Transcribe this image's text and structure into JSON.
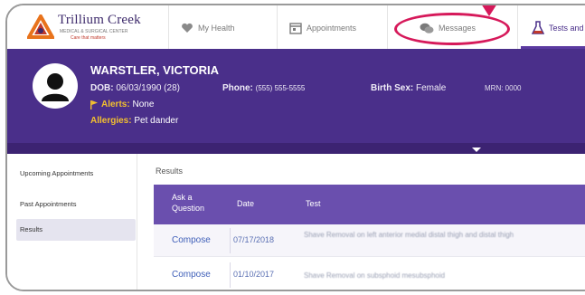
{
  "app": {
    "logo_name": "Trillium Creek",
    "logo_tagline": "MEDICAL & SURGICAL CENTER",
    "logo_tagline2": "Care that matters"
  },
  "nav": {
    "my_health": "My Health",
    "appointments": "Appointments",
    "messages": "Messages",
    "tests": "Tests and"
  },
  "patient": {
    "name": "WARSTLER, VICTORIA",
    "dob_label": "DOB:",
    "dob_value": "06/03/1990 (28)",
    "phone_label": "Phone:",
    "phone_value": "(555) 555-5555",
    "sex_label": "Birth Sex:",
    "sex_value": "Female",
    "mrn": "MRN: 0000",
    "alerts_label": "Alerts:",
    "alerts_value": "None",
    "allergies_label": "Allergies:",
    "allergies_value": "Pet dander"
  },
  "sidebar": {
    "items": [
      {
        "label": "Upcoming Appointments"
      },
      {
        "label": "Past Appointments"
      },
      {
        "label": "Results"
      }
    ]
  },
  "results": {
    "title": "Results",
    "columns": [
      "Ask a Question",
      "Date",
      "Test"
    ],
    "rows": [
      {
        "action": "Compose",
        "date": "07/17/2018",
        "test": "Shave Removal on left anterior medial distal thigh and distal thigh"
      },
      {
        "action": "Compose",
        "date": "01/10/2017",
        "test": "Shave Removal on subsphoid mesubsphoid"
      }
    ]
  },
  "colors": {
    "brand_purple": "#4a2f8a",
    "table_header": "#6a4fae",
    "annotation": "#d6195a",
    "alert_yellow": "#f3c02f"
  }
}
